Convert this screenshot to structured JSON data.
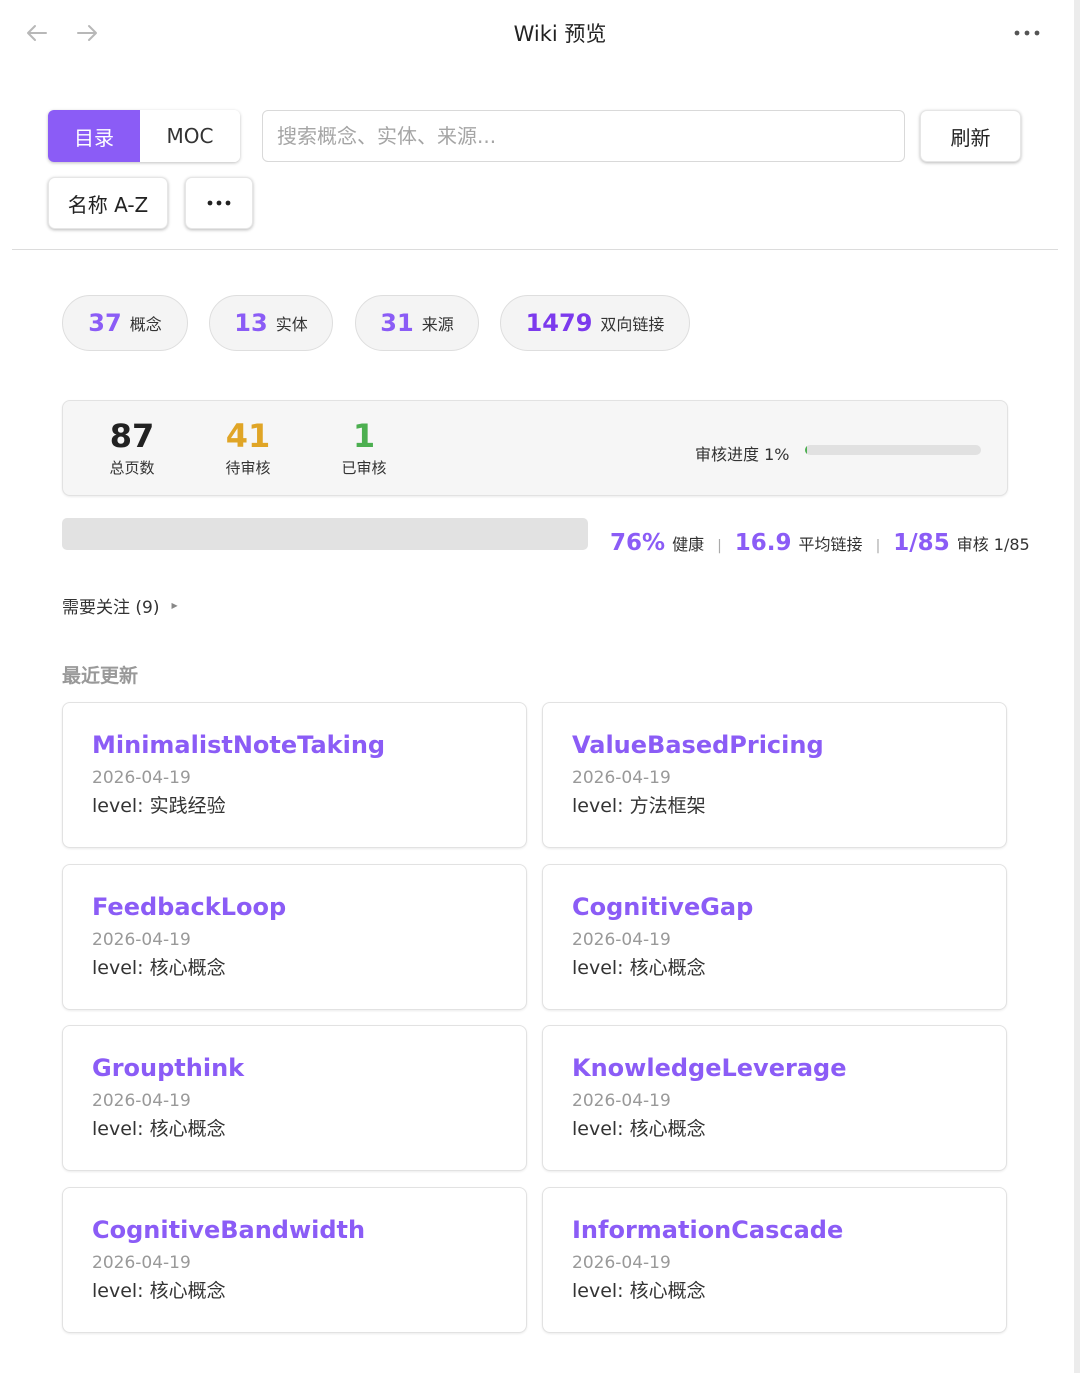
{
  "window": {
    "title": "Wiki 预览"
  },
  "view_tabs": [
    {
      "label": "目录",
      "active": true
    },
    {
      "label": "MOC",
      "active": false
    }
  ],
  "search": {
    "placeholder": "搜索概念、实体、来源...",
    "value": ""
  },
  "toolbar": {
    "refresh_label": "刷新",
    "sort_label": "名称 A-Z",
    "more_label": "..."
  },
  "stats": [
    {
      "value": "37",
      "label": "概念"
    },
    {
      "value": "13",
      "label": "实体"
    },
    {
      "value": "31",
      "label": "来源"
    },
    {
      "value": "1479",
      "label": "双向链接"
    }
  ],
  "summary": {
    "total": {
      "value": "87",
      "label": "总页数",
      "color": "#222222"
    },
    "pending": {
      "value": "41",
      "label": "待审核",
      "color": "#e0a526"
    },
    "reviewed": {
      "value": "1",
      "label": "已审核",
      "color": "#4caf50"
    },
    "progress_label": "审核进度 1%",
    "progress_fraction": 0.01
  },
  "health": {
    "health_value": "76%",
    "health_label": "健康",
    "avg_value": "16.9",
    "avg_label": "平均链接",
    "review_value": "1/85",
    "review_label": "审核 1/85",
    "separator": "|"
  },
  "attention": {
    "label": "需要关注 (9)"
  },
  "recent": {
    "title": "最近更新",
    "cards": [
      {
        "title": "MinimalistNoteTaking",
        "date": "2026-04-19",
        "level": "level: 实践经验"
      },
      {
        "title": "ValueBasedPricing",
        "date": "2026-04-19",
        "level": "level: 方法框架"
      },
      {
        "title": "FeedbackLoop",
        "date": "2026-04-19",
        "level": "level: 核心概念"
      },
      {
        "title": "CognitiveGap",
        "date": "2026-04-19",
        "level": "level: 核心概念"
      },
      {
        "title": "Groupthink",
        "date": "2026-04-19",
        "level": "level: 核心概念"
      },
      {
        "title": "KnowledgeLeverage",
        "date": "2026-04-19",
        "level": "level: 核心概念"
      },
      {
        "title": "CognitiveBandwidth",
        "date": "2026-04-19",
        "level": "level: 核心概念"
      },
      {
        "title": "InformationCascade",
        "date": "2026-04-19",
        "level": "level: 核心概念"
      }
    ]
  },
  "colors": {
    "accent": "#8b5cf6"
  },
  "icons": {
    "back": "arrow-left-icon",
    "forward": "arrow-right-icon",
    "more": "more-horizontal-icon",
    "caret": "caret-right-icon"
  }
}
